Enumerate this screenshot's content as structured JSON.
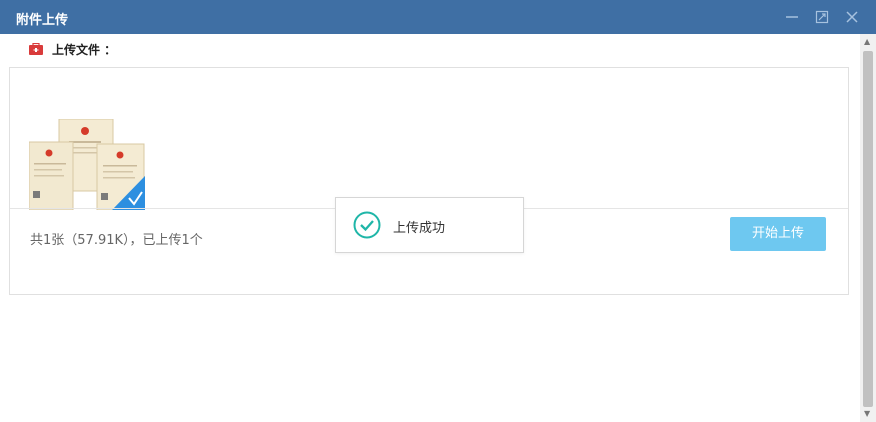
{
  "window": {
    "title": "附件上传",
    "controls": {
      "minimize_icon": "minimize-icon",
      "maximize_icon": "maximize-icon",
      "close_icon": "close-icon"
    }
  },
  "upload": {
    "header_label": "上传文件 ：",
    "summary": "共1张（57.91K），已上传1个",
    "start_button": "开始上传"
  },
  "toast": {
    "message": "上传成功",
    "icon": "check-circle-icon"
  },
  "colors": {
    "titlebar": "#3f6fa4",
    "button": "#6ec8f0",
    "success": "#1fb6a8"
  }
}
